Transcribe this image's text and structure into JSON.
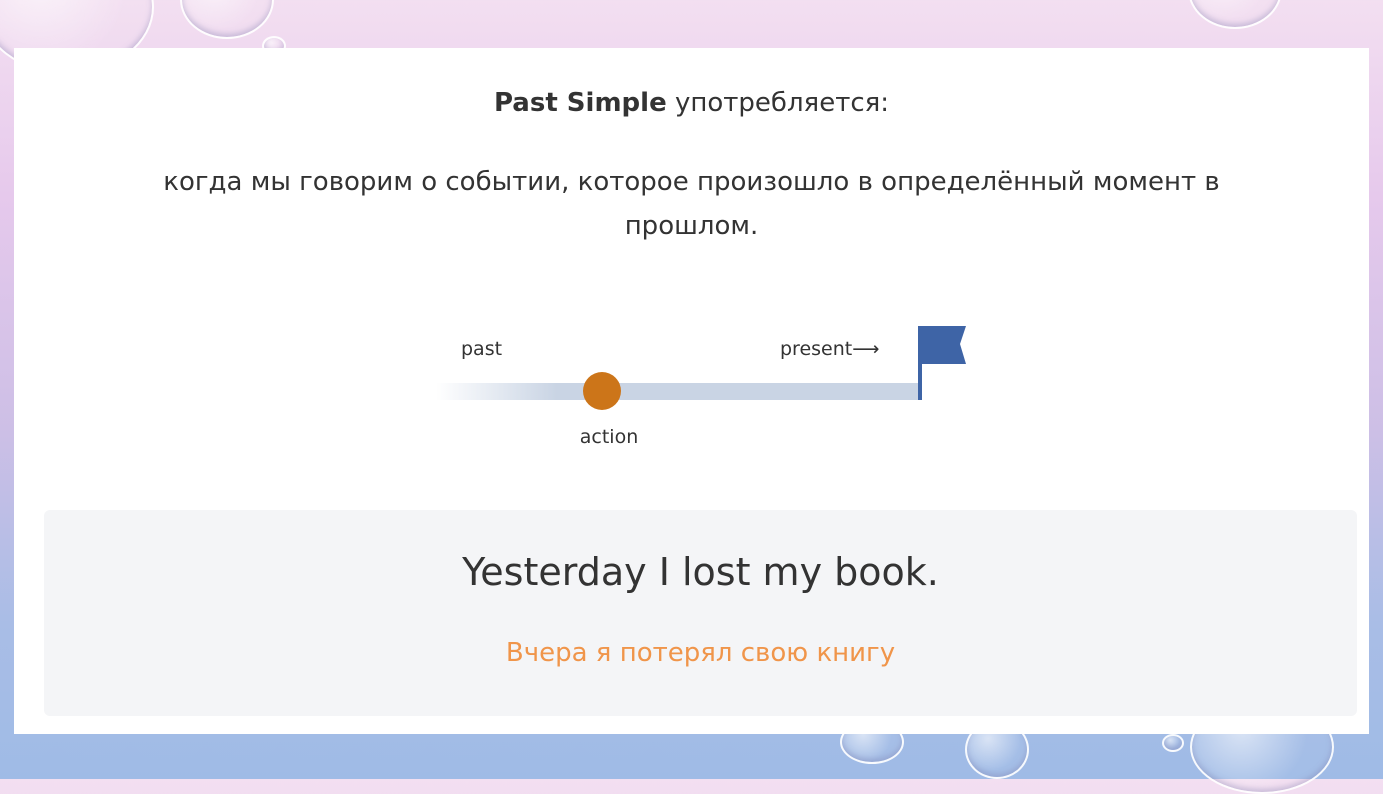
{
  "heading": {
    "term": "Past Simple",
    "rest": " употребляется:"
  },
  "description": "когда мы говорим о событии, которое произошло в определённый момент в прошлом.",
  "timeline": {
    "past_label": "past",
    "present_label": "present⟶",
    "action_label": "action",
    "colors": {
      "line": "#c9d4e4",
      "dot": "#cc7519",
      "flag": "#3e64a6",
      "text": "#333333"
    }
  },
  "example": {
    "english": "Yesterday I lost my book.",
    "russian": "Вчера я потерял свою книгу"
  }
}
